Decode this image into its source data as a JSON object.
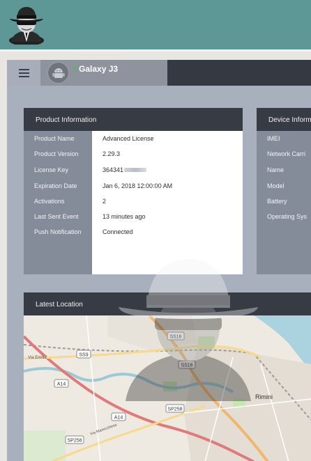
{
  "device": {
    "name": "Galaxy J3",
    "status_color": "#3ec552"
  },
  "product_info": {
    "header": "Product Information",
    "rows": [
      {
        "label": "Product Name",
        "value": "Advanced License"
      },
      {
        "label": "Product Version",
        "value": "2.29.3"
      },
      {
        "label": "License Key",
        "value": "364341"
      },
      {
        "label": "Expiration Date",
        "value": "Jan 6, 2018 12:00:00 AM"
      },
      {
        "label": "Activations",
        "value": "2"
      },
      {
        "label": "Last Sent Event",
        "value": "13 minutes ago"
      },
      {
        "label": "Push Notification",
        "value": "Connected"
      }
    ]
  },
  "device_info": {
    "header": "Device Inform",
    "rows": [
      "IMEI",
      "Network Carri",
      "Name",
      "Model",
      "Battery",
      "Operating Sys"
    ]
  },
  "location": {
    "header": "Latest Location",
    "map_labels": {
      "road_ss16_a": "SS16",
      "road_ss16_b": "SS16",
      "road_ss9": "SS9",
      "road_a14_a": "A14",
      "road_a14_b": "A14",
      "road_sp258_a": "SP258",
      "road_sp258_b": "SP258",
      "city": "Rimini",
      "street": "Via Emilia",
      "river_road": "Via Marecchiese"
    }
  },
  "icons": {
    "logo": "spy-agent-icon",
    "menu": "hamburger-menu-icon",
    "device": "android-icon",
    "watermark": "spy-watermark-icon"
  },
  "colors": {
    "topbar": "#5d9896",
    "dark_header": "#353941",
    "label_panel": "#848b99"
  }
}
